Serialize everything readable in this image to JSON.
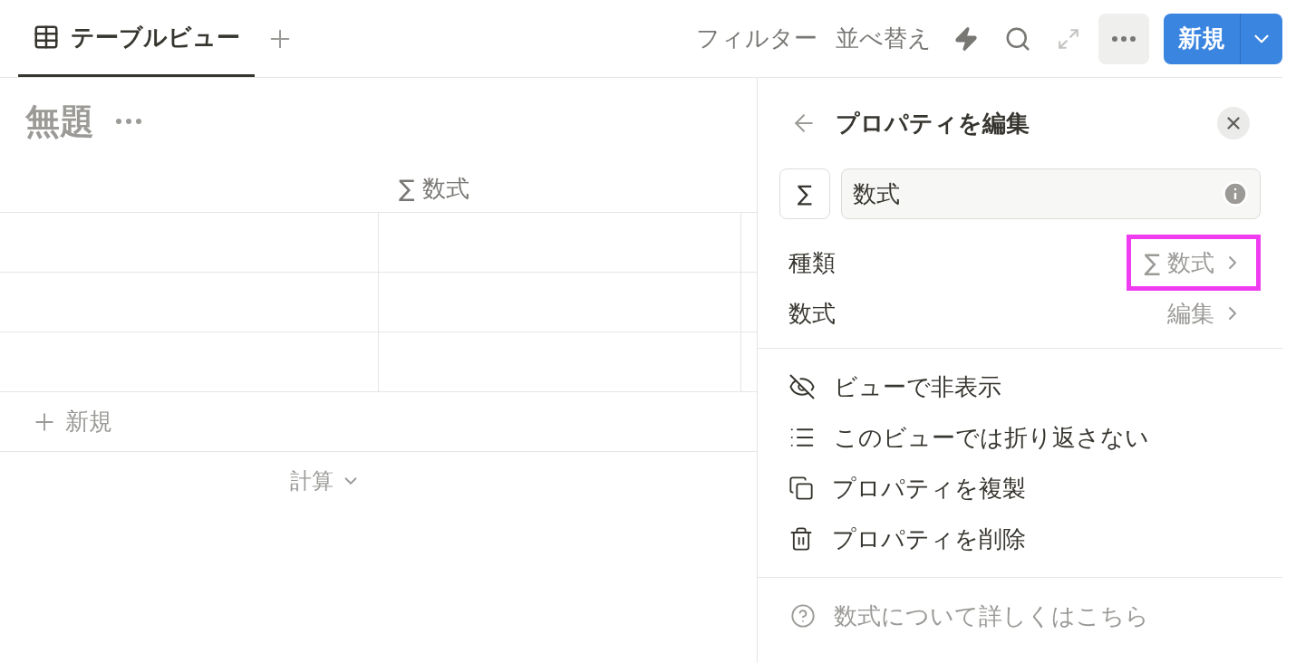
{
  "tabs": [
    {
      "label": "テーブルビュー",
      "selected": true
    }
  ],
  "toolbar": {
    "filter": "フィルター",
    "sort": "並べ替え",
    "new_button": "新規"
  },
  "table": {
    "title": "無題",
    "column": {
      "icon": "∑",
      "label": "数式"
    },
    "add_row": "新規",
    "calculate": "計算"
  },
  "panel": {
    "title": "プロパティを編集",
    "type_icon": "∑",
    "name_value": "数式",
    "properties": [
      {
        "label": "種類",
        "icon": "∑",
        "value": "数式",
        "highlighted": true
      },
      {
        "label": "数式",
        "value": "編集",
        "highlighted": false
      }
    ],
    "actions": [
      {
        "kind": "hide",
        "label": "ビューで非表示"
      },
      {
        "kind": "wrap",
        "label": "このビューでは折り返さない"
      },
      {
        "kind": "duplicate",
        "label": "プロパティを複製"
      },
      {
        "kind": "delete",
        "label": "プロパティを削除"
      }
    ],
    "help": "数式について詳しくはこちら"
  }
}
